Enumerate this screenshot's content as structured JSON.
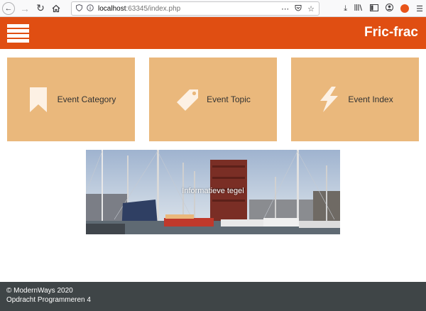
{
  "browser": {
    "url_host": "localhost",
    "url_rest": ":63345/index.php",
    "icons": [
      "back-icon",
      "forward-icon",
      "reload-icon",
      "home-icon",
      "shield-icon",
      "info-icon",
      "more-icon",
      "pocket-icon",
      "bookmark-star-icon",
      "download-icon",
      "library-icon",
      "sidebar-icon",
      "account-icon",
      "extension-icon",
      "menu-icon"
    ]
  },
  "header": {
    "brand": "Fric-frac",
    "menu_icon": "hamburger-icon",
    "color": "#e04e12"
  },
  "tiles": [
    {
      "label": "Event Category",
      "icon": "bookmark-icon"
    },
    {
      "label": "Event Topic",
      "icon": "tag-icon"
    },
    {
      "label": "Event Index",
      "icon": "lightning-icon"
    }
  ],
  "tile_color": "#eab87c",
  "banner": {
    "caption": "Informatieve tegel"
  },
  "footer": {
    "line1": "© ModernWays 2020",
    "line2": "Opdracht Programmeren 4"
  }
}
